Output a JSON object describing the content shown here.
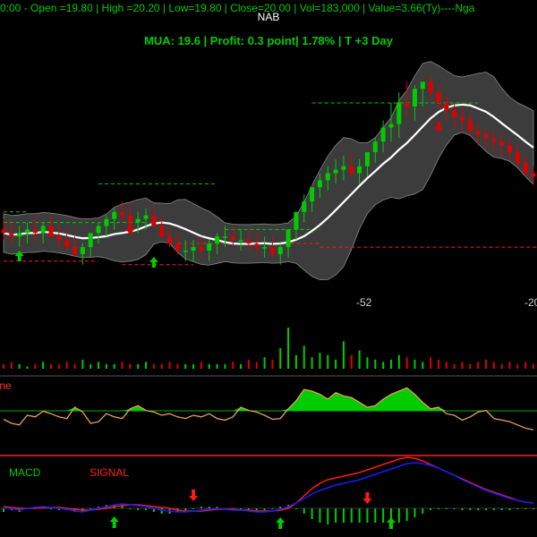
{
  "header": {
    "info_line": "0:00 -  Open =19.80 | High =20.20 | Low=19.80 | Close=20.00 | Vol=183,000 | Value=3.66(Ty)----Nga",
    "symbol": "NAB",
    "trade_line": "MUA:  19.6  | Profit: 0.3 point| 1.78% | T +3 Day"
  },
  "colors": {
    "background": "#000000",
    "up": "#00cc00",
    "down": "#dd0000",
    "band_fill": "#3c3c3c",
    "ma": "#ffffff",
    "line": "#e8a05a",
    "macd": "#1a1aff",
    "signal": "#ff1a1a"
  },
  "chart_data": [
    {
      "panel": "price",
      "type": "candlestick",
      "overlays": [
        "bollinger-bands",
        "moving-average",
        "support-resistance-lines"
      ],
      "price_labels": [
        "-52",
        "-20"
      ],
      "open": [
        18.4,
        18.3,
        18.2,
        18.3,
        18.4,
        18.3,
        18.5,
        18.2,
        18.1,
        17.9,
        17.7,
        17.9,
        18.3,
        18.5,
        18.7,
        18.9,
        18.8,
        18.6,
        18.7,
        18.8,
        18.5,
        18.2,
        18.0,
        17.8,
        17.8,
        17.9,
        17.8,
        18.0,
        18.2,
        18.2,
        18.1,
        18.1,
        18.0,
        17.9,
        17.9,
        17.7,
        17.9,
        18.4,
        18.9,
        19.2,
        19.6,
        19.8,
        20.0,
        20.1,
        20.2,
        20.0,
        20.2,
        20.6,
        20.9,
        21.3,
        21.4,
        22.0,
        21.9,
        22.4,
        22.6,
        22.3,
        22.0,
        21.8,
        21.6,
        21.5,
        21.2,
        21.1,
        21.0,
        20.9,
        20.8,
        20.6,
        20.3,
        20.0
      ],
      "high": [
        18.7,
        18.6,
        18.5,
        18.6,
        18.7,
        18.6,
        18.8,
        18.5,
        18.4,
        18.2,
        18.0,
        18.2,
        18.6,
        18.8,
        19.0,
        19.2,
        19.1,
        18.9,
        19.0,
        19.1,
        18.8,
        18.5,
        18.3,
        18.1,
        18.1,
        18.2,
        18.1,
        18.3,
        18.5,
        18.5,
        18.4,
        18.4,
        18.3,
        18.2,
        18.2,
        18.0,
        18.2,
        18.8,
        19.4,
        19.6,
        20.0,
        20.2,
        20.4,
        20.5,
        20.6,
        20.4,
        20.6,
        21.0,
        21.5,
        22.0,
        22.3,
        22.6,
        22.5,
        22.6,
        22.8,
        22.5,
        22.2,
        22.0,
        21.9,
        21.7,
        21.4,
        21.3,
        21.2,
        21.1,
        21.0,
        20.8,
        20.5,
        20.2
      ],
      "low": [
        18.1,
        18.0,
        17.9,
        18.0,
        18.1,
        18.0,
        18.2,
        17.9,
        17.8,
        17.6,
        17.4,
        17.6,
        18.0,
        18.2,
        18.4,
        18.6,
        18.5,
        18.3,
        18.4,
        18.5,
        18.2,
        17.9,
        17.7,
        17.5,
        17.5,
        17.6,
        17.5,
        17.7,
        17.9,
        17.9,
        17.8,
        17.8,
        17.7,
        17.6,
        17.6,
        17.4,
        17.6,
        18.1,
        18.6,
        18.9,
        19.3,
        19.5,
        19.7,
        19.8,
        19.9,
        19.7,
        19.9,
        20.3,
        20.6,
        20.9,
        21.0,
        21.6,
        21.5,
        21.9,
        22.1,
        21.8,
        21.5,
        21.3,
        21.2,
        21.1,
        20.8,
        20.7,
        20.6,
        20.5,
        20.4,
        20.2,
        19.9,
        19.7
      ],
      "close": [
        18.3,
        18.2,
        18.3,
        18.4,
        18.3,
        18.5,
        18.2,
        18.1,
        17.9,
        17.7,
        17.9,
        18.3,
        18.5,
        18.7,
        18.9,
        18.8,
        18.6,
        18.7,
        18.8,
        18.5,
        18.2,
        18.0,
        17.8,
        17.8,
        17.9,
        17.8,
        18.0,
        18.2,
        18.2,
        18.1,
        18.1,
        18.0,
        17.9,
        17.9,
        17.7,
        17.9,
        18.4,
        18.9,
        19.2,
        19.6,
        19.8,
        20.0,
        20.1,
        20.2,
        20.0,
        20.2,
        20.6,
        20.9,
        21.3,
        21.4,
        22.0,
        21.9,
        22.4,
        22.6,
        22.3,
        22.0,
        21.8,
        21.6,
        21.5,
        21.2,
        21.1,
        21.0,
        20.9,
        20.8,
        20.6,
        20.3,
        20.0,
        19.9
      ]
    },
    {
      "panel": "volume",
      "type": "bar",
      "values": [
        2,
        3,
        2,
        1,
        2,
        3,
        2,
        2,
        3,
        2,
        4,
        2,
        3,
        2,
        2,
        3,
        2,
        2,
        3,
        2,
        2,
        3,
        2,
        2,
        2,
        3,
        2,
        2,
        2,
        3,
        2,
        4,
        3,
        5,
        4,
        9,
        18,
        6,
        10,
        5,
        7,
        6,
        4,
        12,
        6,
        8,
        5,
        4,
        3,
        4,
        6,
        5,
        4,
        3,
        5,
        4,
        3,
        2,
        3,
        2,
        3,
        4,
        3,
        2,
        3,
        2,
        3,
        2
      ]
    },
    {
      "panel": "line-oscillator",
      "type": "line",
      "series_label_fragment": "line",
      "values": [
        35,
        30,
        28,
        40,
        38,
        45,
        42,
        38,
        36,
        50,
        44,
        30,
        32,
        42,
        38,
        36,
        48,
        52,
        46,
        44,
        40,
        42,
        38,
        36,
        40,
        38,
        42,
        36,
        34,
        38,
        50,
        46,
        44,
        40,
        35,
        36,
        48,
        58,
        72,
        70,
        66,
        60,
        68,
        64,
        62,
        56,
        50,
        52,
        60,
        66,
        70,
        74,
        66,
        56,
        48,
        50,
        42,
        40,
        34,
        38,
        44,
        46,
        36,
        34,
        32,
        28,
        24,
        22
      ]
    },
    {
      "panel": "macd",
      "type": "line",
      "legend": [
        "MACD",
        "SIGNAL"
      ],
      "macd": [
        0.0,
        0.0,
        -0.1,
        0.0,
        0.05,
        0.1,
        0.05,
        0.0,
        -0.05,
        -0.15,
        -0.2,
        -0.1,
        0.0,
        0.1,
        0.2,
        0.25,
        0.2,
        0.15,
        0.1,
        0.0,
        -0.1,
        -0.15,
        -0.2,
        -0.2,
        -0.15,
        -0.1,
        -0.05,
        0.0,
        -0.05,
        -0.1,
        -0.1,
        -0.15,
        -0.2,
        -0.2,
        -0.15,
        -0.05,
        0.1,
        0.3,
        0.55,
        0.8,
        1.0,
        1.15,
        1.3,
        1.4,
        1.5,
        1.6,
        1.75,
        1.9,
        2.05,
        2.2,
        2.35,
        2.5,
        2.55,
        2.5,
        2.4,
        2.25,
        2.05,
        1.85,
        1.6,
        1.4,
        1.2,
        1.0,
        0.85,
        0.7,
        0.55,
        0.45,
        0.35,
        0.3
      ],
      "signal": [
        0.1,
        0.05,
        0.0,
        0.0,
        0.0,
        0.05,
        0.05,
        0.05,
        0.0,
        -0.05,
        -0.1,
        -0.1,
        -0.05,
        0.0,
        0.1,
        0.15,
        0.2,
        0.2,
        0.15,
        0.1,
        0.05,
        0.0,
        -0.1,
        -0.15,
        -0.15,
        -0.15,
        -0.1,
        -0.05,
        -0.05,
        -0.05,
        -0.1,
        -0.1,
        -0.15,
        -0.15,
        -0.15,
        -0.1,
        0.0,
        0.3,
        0.7,
        1.1,
        1.4,
        1.6,
        1.7,
        1.8,
        1.9,
        2.0,
        2.15,
        2.3,
        2.45,
        2.6,
        2.75,
        2.85,
        2.8,
        2.65,
        2.45,
        2.25,
        2.05,
        1.85,
        1.65,
        1.45,
        1.25,
        1.05,
        0.9,
        0.75,
        0.6,
        0.45,
        0.35,
        0.3
      ]
    }
  ]
}
